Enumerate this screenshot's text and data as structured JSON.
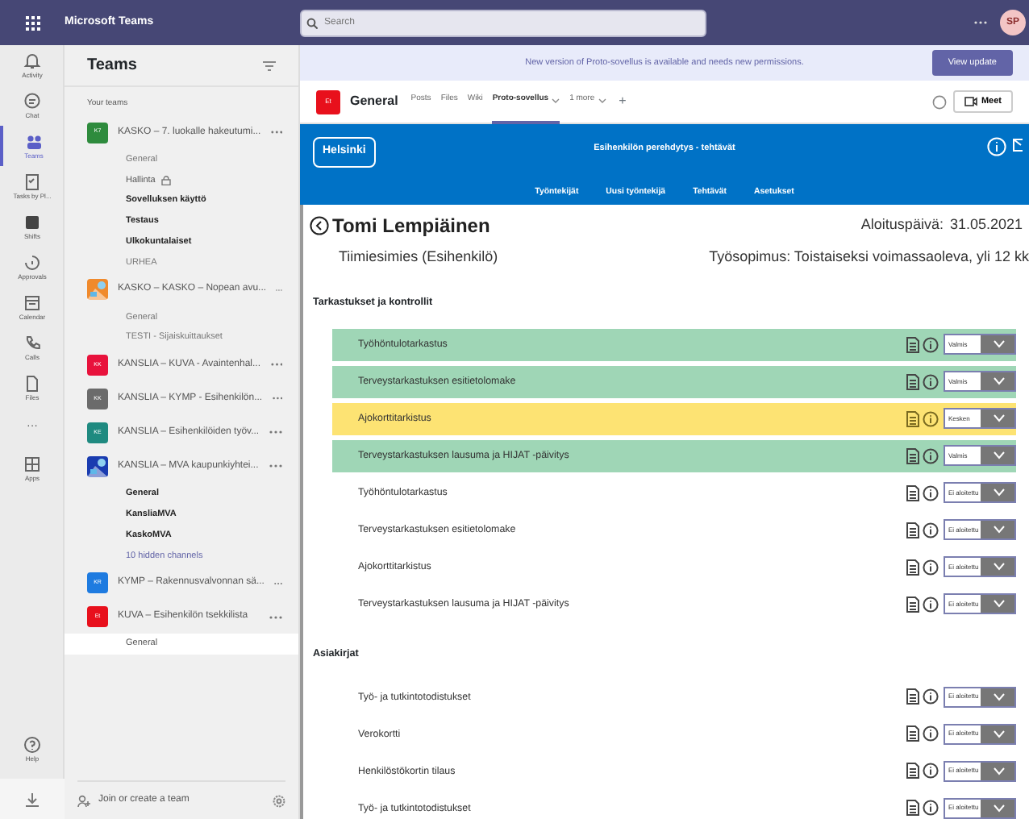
{
  "app_title": "Microsoft Teams",
  "search": {
    "placeholder": "Search"
  },
  "profile": {
    "initials": "SP"
  },
  "rail": [
    {
      "label": "Activity",
      "selected": false
    },
    {
      "label": "Chat",
      "selected": false
    },
    {
      "label": "Teams",
      "selected": true
    },
    {
      "label": "Tasks by Pl...",
      "selected": false
    },
    {
      "label": "Shifts",
      "selected": false
    },
    {
      "label": "Approvals",
      "selected": false
    },
    {
      "label": "Calendar",
      "selected": false
    },
    {
      "label": "Calls",
      "selected": false
    },
    {
      "label": "Files",
      "selected": false
    },
    {
      "label": "···",
      "selected": false
    },
    {
      "label": "Apps",
      "selected": false
    }
  ],
  "rail_bottom": [
    {
      "label": "Help"
    }
  ],
  "teams_panel": {
    "title": "Teams",
    "section": "Your teams",
    "join": "Join or create a team",
    "teams": [
      {
        "name": "KASKO – 7. luokalle hakeutumi...",
        "initials": "K7",
        "color": "#2e8b3d",
        "kind": "initials",
        "channels": [
          {
            "name": "General",
            "kind": "channel",
            "unread": false,
            "selected": false
          },
          {
            "name": "Hallinta",
            "kind": "private",
            "unread": false,
            "selected": false
          },
          {
            "name": "Sovelluksen käyttö",
            "kind": "channel",
            "unread": true,
            "selected": false
          },
          {
            "name": "Testaus",
            "kind": "channel",
            "unread": true,
            "selected": false
          },
          {
            "name": "Ulkokuntalaiset",
            "kind": "channel",
            "unread": true,
            "selected": false
          },
          {
            "name": "URHEA",
            "kind": "channel",
            "unread": false,
            "selected": false
          }
        ]
      },
      {
        "name": "KASKO – KASKO – Nopean avu...",
        "kind": "picture",
        "channels": [
          {
            "name": "General",
            "kind": "channel",
            "unread": false,
            "selected": false
          },
          {
            "name": "TESTI - Sijaiskuittaukset",
            "kind": "channel",
            "unread": false,
            "selected": false
          }
        ]
      },
      {
        "name": "KANSLIA – KUVA - Avaintenhal...",
        "initials": "KK",
        "color": "#e8123c",
        "kind": "initials"
      },
      {
        "name": "KANSLIA – KYMP - Esihenkilön...",
        "initials": "KK",
        "color": "#6b6b6b",
        "kind": "initials"
      },
      {
        "name": "KANSLIA – Esihenkilöiden työv...",
        "initials": "KE",
        "color": "#1f8a80",
        "kind": "initials"
      },
      {
        "name": "KANSLIA – MVA kaupunkiyhtei...",
        "kind": "picture",
        "channels": [
          {
            "name": "General",
            "kind": "channel",
            "unread": true,
            "selected": false
          },
          {
            "name": "KansliaMVA",
            "kind": "channel",
            "unread": true,
            "selected": false
          },
          {
            "name": "KaskoMVA",
            "kind": "channel",
            "unread": true,
            "selected": false
          },
          {
            "name": "10 hidden channels",
            "kind": "link",
            "unread": false,
            "selected": false
          }
        ]
      },
      {
        "name": "KYMP – Rakennusvalvonnan sä...",
        "initials": "KR",
        "color": "#1e7be0",
        "kind": "initials"
      },
      {
        "name": "KUVA – Esihenkilön tsekkilista",
        "initials": "Et",
        "color": "#e8101c",
        "kind": "initials",
        "channels": [
          {
            "name": "General",
            "kind": "channel",
            "unread": false,
            "selected": true
          }
        ]
      }
    ]
  },
  "banner": {
    "text": "New version of Proto-sovellus is available and needs new permissions.",
    "button": "View update"
  },
  "channel_header": {
    "initials": "Et",
    "title": "General",
    "tabs": [
      {
        "label": "Posts",
        "selected": false,
        "dropdown": false
      },
      {
        "label": "Files",
        "selected": false,
        "dropdown": false
      },
      {
        "label": "Wiki",
        "selected": false,
        "dropdown": false
      },
      {
        "label": "Proto-sovellus",
        "selected": true,
        "dropdown": true
      },
      {
        "label": "1 more",
        "selected": false,
        "dropdown": true
      }
    ],
    "add": "+",
    "meet": "Meet"
  },
  "app": {
    "logo": "Helsinki",
    "title": "Esihenkilön perehdytys - tehtävät",
    "nav": [
      "Työntekijät",
      "Uusi työntekijä",
      "Tehtävät",
      "Asetukset"
    ],
    "person": {
      "name": "Tomi Lempiäinen",
      "start_label": "Aloituspäivä:",
      "start_date": "31.05.2021",
      "role": "Tiimiesimies (Esihenkilö)",
      "contract": "Työsopimus: Toistaiseksi voimassaoleva, yli 12 kk"
    },
    "sections": [
      {
        "title": "Tarkastukset ja kontrollit",
        "tasks": [
          {
            "name": "Työhöntulotarkastus",
            "status": "Valmis",
            "kind": "done"
          },
          {
            "name": "Terveystarkastuksen esitietolomake",
            "status": "Valmis",
            "kind": "done"
          },
          {
            "name": "Ajokorttitarkistus",
            "status": "Kesken",
            "kind": "in_progress"
          },
          {
            "name": "Terveystarkastuksen lausuma ja HIJAT -päivitys",
            "status": "Valmis",
            "kind": "done"
          },
          {
            "name": "Työhöntulotarkastus",
            "status": "Ei aloitettu",
            "kind": "not_started"
          },
          {
            "name": "Terveystarkastuksen esitietolomake",
            "status": "Ei aloitettu",
            "kind": "not_started"
          },
          {
            "name": "Ajokorttitarkistus",
            "status": "Ei aloitettu",
            "kind": "not_started"
          },
          {
            "name": "Terveystarkastuksen lausuma ja HIJAT -päivitys",
            "status": "Ei aloitettu",
            "kind": "not_started"
          }
        ]
      },
      {
        "title": "Asiakirjat",
        "tasks": [
          {
            "name": "Työ- ja tutkintotodistukset",
            "status": "Ei aloitettu",
            "kind": "not_started"
          },
          {
            "name": "Verokortti",
            "status": "Ei aloitettu",
            "kind": "not_started"
          },
          {
            "name": "Henkilöstökortin tilaus",
            "status": "Ei aloitettu",
            "kind": "not_started"
          },
          {
            "name": "Työ- ja tutkintotodistukset",
            "status": "Ei aloitettu",
            "kind": "not_started"
          }
        ]
      }
    ]
  }
}
